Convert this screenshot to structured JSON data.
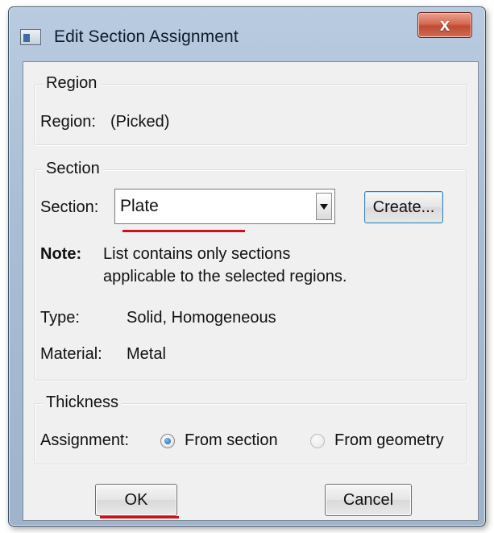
{
  "window": {
    "title": "Edit Section Assignment",
    "close_label": "x"
  },
  "region": {
    "group_label": "Region",
    "label": "Region:",
    "value": "(Picked)"
  },
  "section": {
    "group_label": "Section",
    "label": "Section:",
    "selected": "Plate",
    "create_button": "Create...",
    "note_label": "Note:",
    "note_line1": "List contains only sections",
    "note_line2": "applicable to the selected regions.",
    "type_label": "Type:",
    "type_value": "Solid, Homogeneous",
    "material_label": "Material:",
    "material_value": "Metal"
  },
  "thickness": {
    "group_label": "Thickness",
    "assignment_label": "Assignment:",
    "option_section": "From section",
    "option_geometry": "From geometry",
    "selected_option": "From section"
  },
  "buttons": {
    "ok": "OK",
    "cancel": "Cancel"
  },
  "colors": {
    "accent_underline": "#c8141e",
    "title_bar": "#a9bdd4",
    "close_button": "#c14a33"
  }
}
